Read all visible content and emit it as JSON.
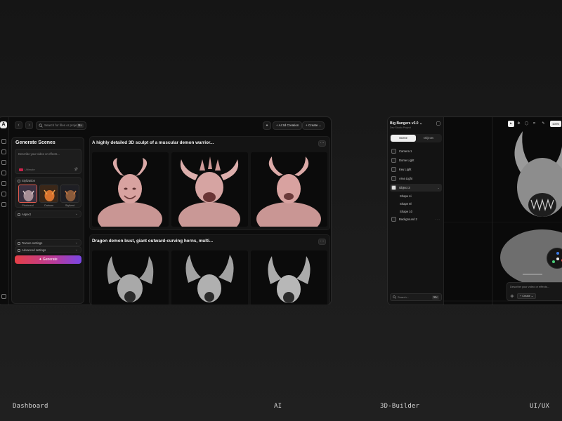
{
  "dashboard": {
    "search": {
      "placeholder": "Search for files or projects...",
      "shortcut": "⌘K"
    },
    "toolbar": {
      "ai_label": "AI 3d Creation",
      "create_label": "Create"
    },
    "panel": {
      "title": "Generate Scenes",
      "prompt_placeholder": "Describe your video or effects...",
      "prompt_chip": "Ultimate",
      "stylization_label": "Stylization",
      "styles": [
        "Photoreal",
        "Cartoon",
        "Stylized"
      ],
      "aspect_label": "Aspect",
      "texture_label": "Texture settings",
      "advanced_label": "Advanced settings",
      "generate_label": "Generate"
    },
    "cards": [
      {
        "title": "A highly detailed 3D sculpt of a muscular demon warrior...",
        "more": "···",
        "tone": "#d8a2a0"
      },
      {
        "title": "Dragon demon bust, giant outward-curving horns, multi...",
        "more": "···",
        "tone": "#b9b9b9"
      }
    ]
  },
  "builder": {
    "project_title": "Big Bangers v3.0",
    "project_sub": "Dev Studio Project",
    "tabs": [
      "Scene",
      "Objects"
    ],
    "layers": [
      {
        "label": "Camera 1",
        "sub": false
      },
      {
        "label": "Dome Light",
        "sub": false
      },
      {
        "label": "Key Light",
        "sub": false
      },
      {
        "label": "Area Light",
        "sub": false
      },
      {
        "label": "Object 3",
        "sub": false,
        "selected": true
      },
      {
        "label": "Shape 4i",
        "sub": true
      },
      {
        "label": "Shape 8l",
        "sub": true
      },
      {
        "label": "Shape 10",
        "sub": true
      },
      {
        "label": "Background 2",
        "sub": false
      }
    ],
    "search_placeholder": "Search...",
    "search_shortcut": "⌘K",
    "zoom": "100%",
    "prompt_placeholder": "Describe your video or effects...",
    "create_label": "Create"
  },
  "captions": [
    "Dashboard",
    "AI",
    "3D-Builder",
    "UI/UX"
  ]
}
